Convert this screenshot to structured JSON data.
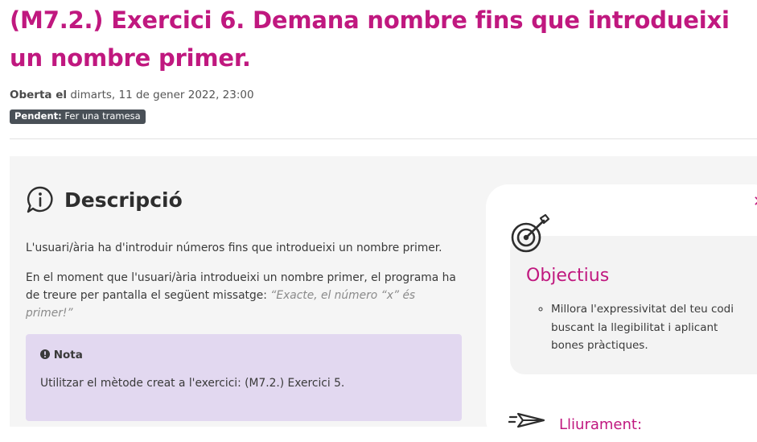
{
  "assignment": {
    "title": "(M7.2.) Exercici 6. Demana nombre fins que introdueixi un nombre primer.",
    "opened_label": "Oberta el",
    "opened_date": "dimarts, 11 de gener 2022, 23:00",
    "status_label": "Pendent:",
    "status_text": "Fer una tramesa"
  },
  "description": {
    "icon": "info-bubble-icon",
    "heading": "Descripció",
    "paragraph1": "L'usuari/ària ha d'introduir números fins que introdueixi un nombre primer.",
    "paragraph2": "En el moment que l'usuari/ària introdueixi un nombre primer, el programa ha de treure per pantalla el següent missatge:",
    "paragraph2_quote": "“Exacte, el número “x” és primer!”"
  },
  "note": {
    "icon": "exclamation-circle-icon",
    "title": "Nota",
    "text": "Utilitzar el mètode creat a l'exercici: (M7.2.) Exercici 5."
  },
  "objectives": {
    "icon": "target-icon",
    "heading": "Objectius",
    "items": [
      "Millora l'expressivitat del teu codi buscant la llegibilitat i aplicant bones pràctiques."
    ]
  },
  "delivery": {
    "icon": "paper-plane-icon",
    "heading": "Lliurament:"
  },
  "colors": {
    "accent": "#c0187f",
    "badge": "#495057",
    "note_background": "#e2d8f0",
    "panel_background": "#f5f5f5"
  }
}
